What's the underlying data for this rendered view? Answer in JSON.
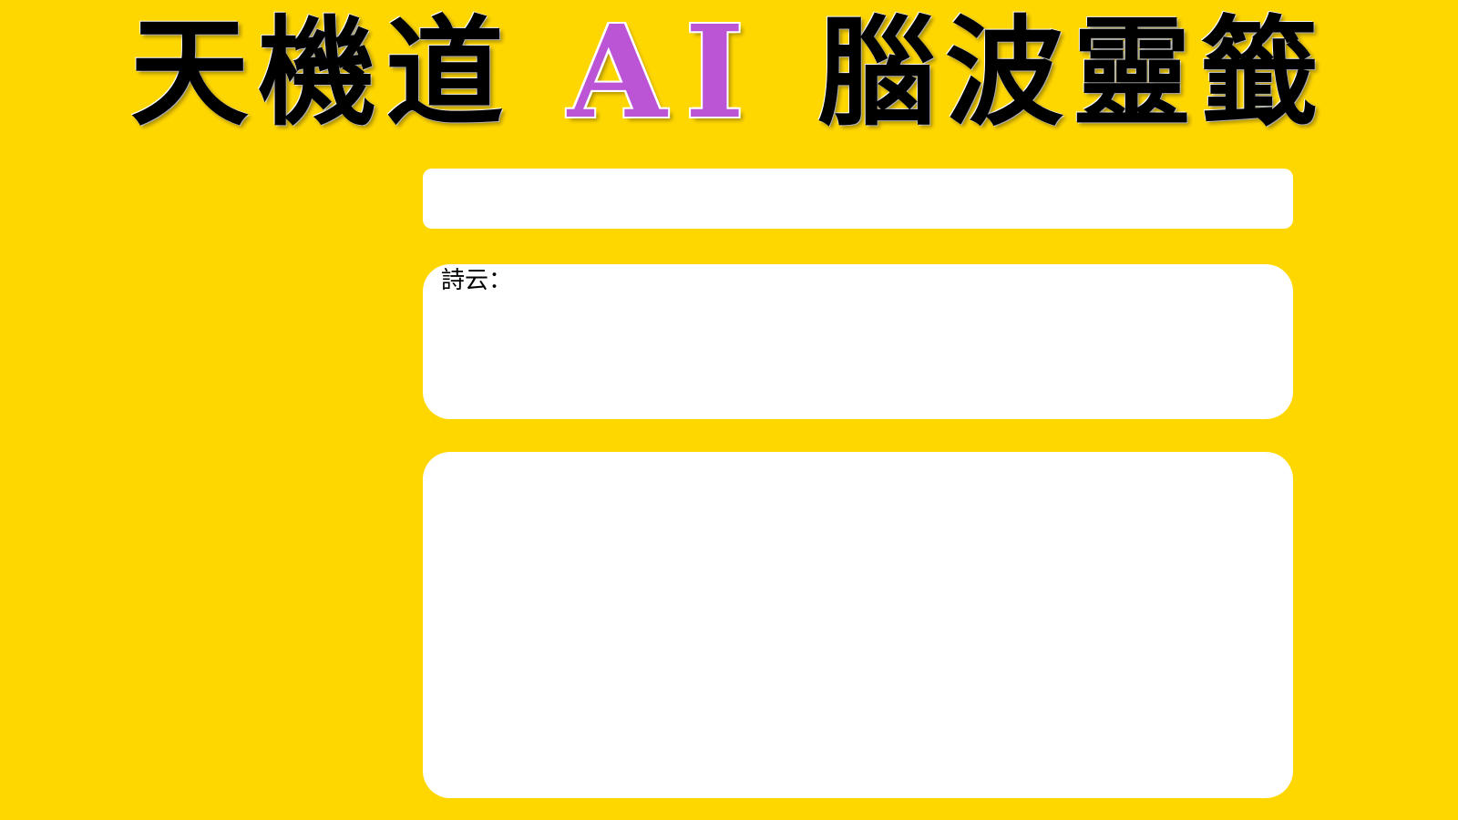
{
  "header": {
    "title_left": "天機道",
    "title_ai": "AI",
    "title_right": "腦波靈籤"
  },
  "question": {
    "value": "",
    "placeholder": ""
  },
  "poem": {
    "label": "詩云："
  },
  "result": {
    "text": ""
  },
  "colors": {
    "background": "#FFD700",
    "accent_ai": "#BB55D6",
    "panel": "#FFFFFF"
  }
}
